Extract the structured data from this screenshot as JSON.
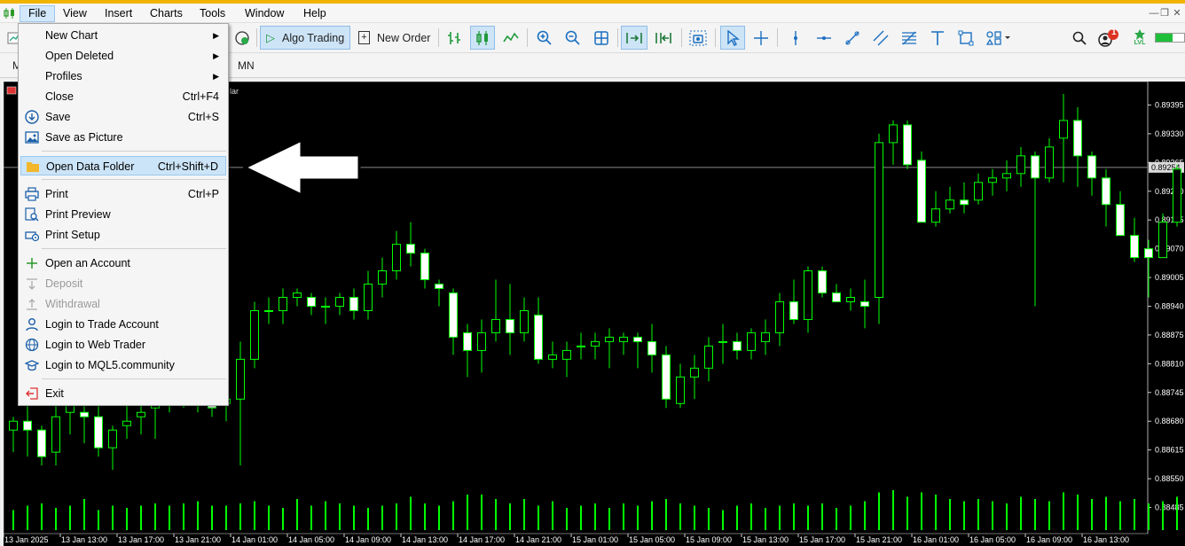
{
  "menubar": {
    "items": [
      {
        "label": "File",
        "active": true
      },
      {
        "label": "View"
      },
      {
        "label": "Insert"
      },
      {
        "label": "Charts"
      },
      {
        "label": "Tools"
      },
      {
        "label": "Window"
      },
      {
        "label": "Help"
      }
    ],
    "window_controls": [
      "minimize-icon",
      "restore-icon",
      "close-icon"
    ]
  },
  "toolbar": {
    "algo_trading_label": "Algo Trading",
    "new_order_label": "New Order",
    "notification_count": "1",
    "lvl_label": "LVL"
  },
  "timeframes": {
    "left_partial": "M",
    "visible": "MN"
  },
  "chart": {
    "title_fragment": "lar",
    "bid_price": "0.89254",
    "colors": {
      "background": "#000000",
      "candle": "#00ff00",
      "body_up": "#000000",
      "body_down": "#ffffff",
      "volume": "#00ff00",
      "text": "#ffffff"
    }
  },
  "file_menu": {
    "items": [
      {
        "label": "New Chart",
        "submenu": true
      },
      {
        "label": "Open Deleted",
        "submenu": true
      },
      {
        "label": "Profiles",
        "submenu": true
      },
      {
        "label": "Close",
        "shortcut": "Ctrl+F4"
      },
      {
        "label": "Save",
        "shortcut": "Ctrl+S",
        "icon": "save-icon"
      },
      {
        "label": "Save as Picture",
        "icon": "picture-icon"
      },
      {
        "label": "Open Data Folder",
        "shortcut": "Ctrl+Shift+D",
        "icon": "folder-icon",
        "highlighted": true
      },
      {
        "label": "Print",
        "shortcut": "Ctrl+P",
        "icon": "printer-icon"
      },
      {
        "label": "Print Preview",
        "icon": "print-preview-icon"
      },
      {
        "label": "Print Setup",
        "icon": "print-setup-icon"
      },
      {
        "label": "Open an Account",
        "icon": "plus-icon"
      },
      {
        "label": "Deposit",
        "icon": "deposit-icon",
        "disabled": true
      },
      {
        "label": "Withdrawal",
        "icon": "withdrawal-icon",
        "disabled": true
      },
      {
        "label": "Login to Trade Account",
        "icon": "user-icon"
      },
      {
        "label": "Login to Web Trader",
        "icon": "globe-icon"
      },
      {
        "label": "Login to MQL5.community",
        "icon": "graduation-cap-icon"
      },
      {
        "label": "Exit",
        "icon": "exit-icon"
      }
    ]
  },
  "chart_data": {
    "type": "candlestick",
    "title": "",
    "xlabel": "",
    "ylabel": "",
    "y_ticks": [
      "0.89395",
      "0.89330",
      "0.89265",
      "0.89200",
      "0.89135",
      "0.89070",
      "0.89005",
      "0.88940",
      "0.88875",
      "0.88810",
      "0.88745",
      "0.88680",
      "0.88615",
      "0.88550",
      "0.88485"
    ],
    "x_ticks": [
      "13 Jan 2025",
      "13 Jan 13:00",
      "13 Jan 17:00",
      "13 Jan 21:00",
      "14 Jan 01:00",
      "14 Jan 05:00",
      "14 Jan 09:00",
      "14 Jan 13:00",
      "14 Jan 17:00",
      "14 Jan 21:00",
      "15 Jan 01:00",
      "15 Jan 05:00",
      "15 Jan 09:00",
      "15 Jan 13:00",
      "15 Jan 17:00",
      "15 Jan 21:00",
      "16 Jan 01:00",
      "16 Jan 05:00",
      "16 Jan 09:00",
      "16 Jan 13:00"
    ],
    "ylim": [
      0.8847,
      0.89432
    ],
    "current_price": 0.89254,
    "candles": [
      [
        0.8866,
        0.8869,
        0.8861,
        0.8868
      ],
      [
        0.8868,
        0.8872,
        0.886,
        0.8866
      ],
      [
        0.8866,
        0.8867,
        0.8858,
        0.886
      ],
      [
        0.8861,
        0.8872,
        0.8858,
        0.8869
      ],
      [
        0.887,
        0.8878,
        0.8865,
        0.8874
      ],
      [
        0.887,
        0.8873,
        0.8863,
        0.8869
      ],
      [
        0.8869,
        0.8872,
        0.886,
        0.8862
      ],
      [
        0.8862,
        0.8867,
        0.8857,
        0.8866
      ],
      [
        0.8867,
        0.8872,
        0.8864,
        0.8868
      ],
      [
        0.8869,
        0.8873,
        0.8865,
        0.887
      ],
      [
        0.8871,
        0.8876,
        0.8864,
        0.8873
      ],
      [
        0.8873,
        0.8879,
        0.887,
        0.8876
      ],
      [
        0.8877,
        0.8885,
        0.8871,
        0.888
      ],
      [
        0.8876,
        0.888,
        0.887,
        0.8872
      ],
      [
        0.8872,
        0.8874,
        0.8869,
        0.8871
      ],
      [
        0.8872,
        0.8876,
        0.8868,
        0.8873
      ],
      [
        0.8873,
        0.8886,
        0.8858,
        0.8882
      ],
      [
        0.8882,
        0.8895,
        0.888,
        0.8893
      ],
      [
        0.8893,
        0.8896,
        0.889,
        0.8893
      ],
      [
        0.8893,
        0.8898,
        0.889,
        0.8896
      ],
      [
        0.8896,
        0.8898,
        0.8894,
        0.8897
      ],
      [
        0.8896,
        0.8897,
        0.8892,
        0.8894
      ],
      [
        0.8894,
        0.8896,
        0.889,
        0.8894
      ],
      [
        0.8894,
        0.8897,
        0.8892,
        0.8896
      ],
      [
        0.8896,
        0.8898,
        0.8891,
        0.8893
      ],
      [
        0.8893,
        0.8902,
        0.8891,
        0.8899
      ],
      [
        0.8899,
        0.8905,
        0.8896,
        0.8902
      ],
      [
        0.8902,
        0.8911,
        0.89,
        0.8908
      ],
      [
        0.8908,
        0.8913,
        0.8903,
        0.8906
      ],
      [
        0.8906,
        0.8907,
        0.8898,
        0.89
      ],
      [
        0.8899,
        0.89,
        0.8894,
        0.8898
      ],
      [
        0.8897,
        0.8898,
        0.8883,
        0.8887
      ],
      [
        0.8888,
        0.889,
        0.8878,
        0.8884
      ],
      [
        0.8884,
        0.8891,
        0.8879,
        0.8888
      ],
      [
        0.8888,
        0.89,
        0.8886,
        0.8891
      ],
      [
        0.8891,
        0.8899,
        0.8883,
        0.8888
      ],
      [
        0.8888,
        0.8896,
        0.8886,
        0.8893
      ],
      [
        0.8892,
        0.8896,
        0.8881,
        0.8882
      ],
      [
        0.8882,
        0.8886,
        0.888,
        0.8883
      ],
      [
        0.8882,
        0.8886,
        0.8878,
        0.8884
      ],
      [
        0.8885,
        0.8888,
        0.8882,
        0.8885
      ],
      [
        0.8885,
        0.8888,
        0.8882,
        0.8886
      ],
      [
        0.8886,
        0.8889,
        0.888,
        0.8887
      ],
      [
        0.8886,
        0.8888,
        0.8883,
        0.8887
      ],
      [
        0.8887,
        0.8888,
        0.888,
        0.8886
      ],
      [
        0.8886,
        0.889,
        0.8879,
        0.8883
      ],
      [
        0.8883,
        0.8885,
        0.8871,
        0.8873
      ],
      [
        0.8872,
        0.8881,
        0.8871,
        0.8878
      ],
      [
        0.8878,
        0.8883,
        0.8873,
        0.888
      ],
      [
        0.888,
        0.8887,
        0.8877,
        0.8885
      ],
      [
        0.8886,
        0.889,
        0.8881,
        0.8886
      ],
      [
        0.8886,
        0.8888,
        0.8882,
        0.8884
      ],
      [
        0.8884,
        0.8889,
        0.8882,
        0.8888
      ],
      [
        0.8886,
        0.8891,
        0.8883,
        0.8888
      ],
      [
        0.8888,
        0.8897,
        0.8885,
        0.8895
      ],
      [
        0.8895,
        0.89,
        0.889,
        0.8891
      ],
      [
        0.8891,
        0.8903,
        0.8888,
        0.8902
      ],
      [
        0.8902,
        0.8903,
        0.8896,
        0.8897
      ],
      [
        0.8897,
        0.8899,
        0.8895,
        0.8895
      ],
      [
        0.8895,
        0.8898,
        0.8893,
        0.8896
      ],
      [
        0.8895,
        0.89,
        0.8889,
        0.8894
      ],
      [
        0.8896,
        0.8933,
        0.889,
        0.8931
      ],
      [
        0.8931,
        0.8936,
        0.8926,
        0.8935
      ],
      [
        0.8935,
        0.8936,
        0.8925,
        0.8926
      ],
      [
        0.8927,
        0.8929,
        0.8913,
        0.8913
      ],
      [
        0.8913,
        0.892,
        0.8912,
        0.8916
      ],
      [
        0.8916,
        0.8921,
        0.8915,
        0.8918
      ],
      [
        0.8918,
        0.8922,
        0.8915,
        0.8917
      ],
      [
        0.8918,
        0.8924,
        0.8917,
        0.8922
      ],
      [
        0.8922,
        0.8925,
        0.8919,
        0.8923
      ],
      [
        0.8923,
        0.8927,
        0.892,
        0.8924
      ],
      [
        0.8924,
        0.893,
        0.8921,
        0.8928
      ],
      [
        0.8928,
        0.8929,
        0.8894,
        0.8923
      ],
      [
        0.8923,
        0.8932,
        0.8922,
        0.893
      ],
      [
        0.8932,
        0.8942,
        0.8922,
        0.8936
      ],
      [
        0.8936,
        0.8939,
        0.8921,
        0.8928
      ],
      [
        0.8928,
        0.8929,
        0.8919,
        0.8923
      ],
      [
        0.8923,
        0.8925,
        0.8912,
        0.8917
      ],
      [
        0.8917,
        0.892,
        0.891,
        0.891
      ],
      [
        0.891,
        0.8914,
        0.8904,
        0.8905
      ],
      [
        0.8907,
        0.8909,
        0.8896,
        0.8905
      ],
      [
        0.8905,
        0.8915,
        0.8905,
        0.8913
      ],
      [
        0.8913,
        0.8926,
        0.8912,
        0.8925
      ],
      [
        0.8925,
        0.8928,
        0.8922,
        0.8924
      ],
      [
        0.8926,
        0.8939,
        0.8925,
        0.8937
      ],
      [
        0.8937,
        0.8938,
        0.8927,
        0.8928
      ],
      [
        0.8928,
        0.8934,
        0.8926,
        0.8926
      ],
      [
        0.8926,
        0.8929,
        0.8924,
        0.8927
      ],
      [
        0.8927,
        0.893,
        0.8922,
        0.8926
      ],
      [
        0.8927,
        0.8929,
        0.8912,
        0.8913
      ],
      [
        0.8913,
        0.8925,
        0.8908,
        0.8923
      ],
      [
        0.8923,
        0.8926,
        0.892,
        0.8926
      ]
    ],
    "volume": [
      0.45,
      0.55,
      0.6,
      0.5,
      0.55,
      0.7,
      0.45,
      0.55,
      0.5,
      0.55,
      0.6,
      0.55,
      0.6,
      0.65,
      0.55,
      0.55,
      0.6,
      0.65,
      0.55,
      0.5,
      0.7,
      0.55,
      0.65,
      0.6,
      0.55,
      0.5,
      0.55,
      0.6,
      0.75,
      0.6,
      0.55,
      0.65,
      0.8,
      0.8,
      0.7,
      0.6,
      0.7,
      0.55,
      0.65,
      0.5,
      0.55,
      0.6,
      0.5,
      0.6,
      0.55,
      0.65,
      0.7,
      0.6,
      0.55,
      0.5,
      0.45,
      0.55,
      0.6,
      0.5,
      0.55,
      0.6,
      0.55,
      0.6,
      0.5,
      0.55,
      0.65,
      0.85,
      0.9,
      0.75,
      0.85,
      0.8,
      0.7,
      0.65,
      0.7,
      0.65,
      0.6,
      0.75,
      0.7,
      0.65,
      0.85,
      0.8,
      0.7,
      0.75,
      0.65,
      0.7,
      0.6,
      0.65,
      0.75,
      0.7,
      0.85,
      0.8,
      0.75,
      0.6,
      0.65,
      0.7,
      0.75,
      0.65
    ]
  }
}
